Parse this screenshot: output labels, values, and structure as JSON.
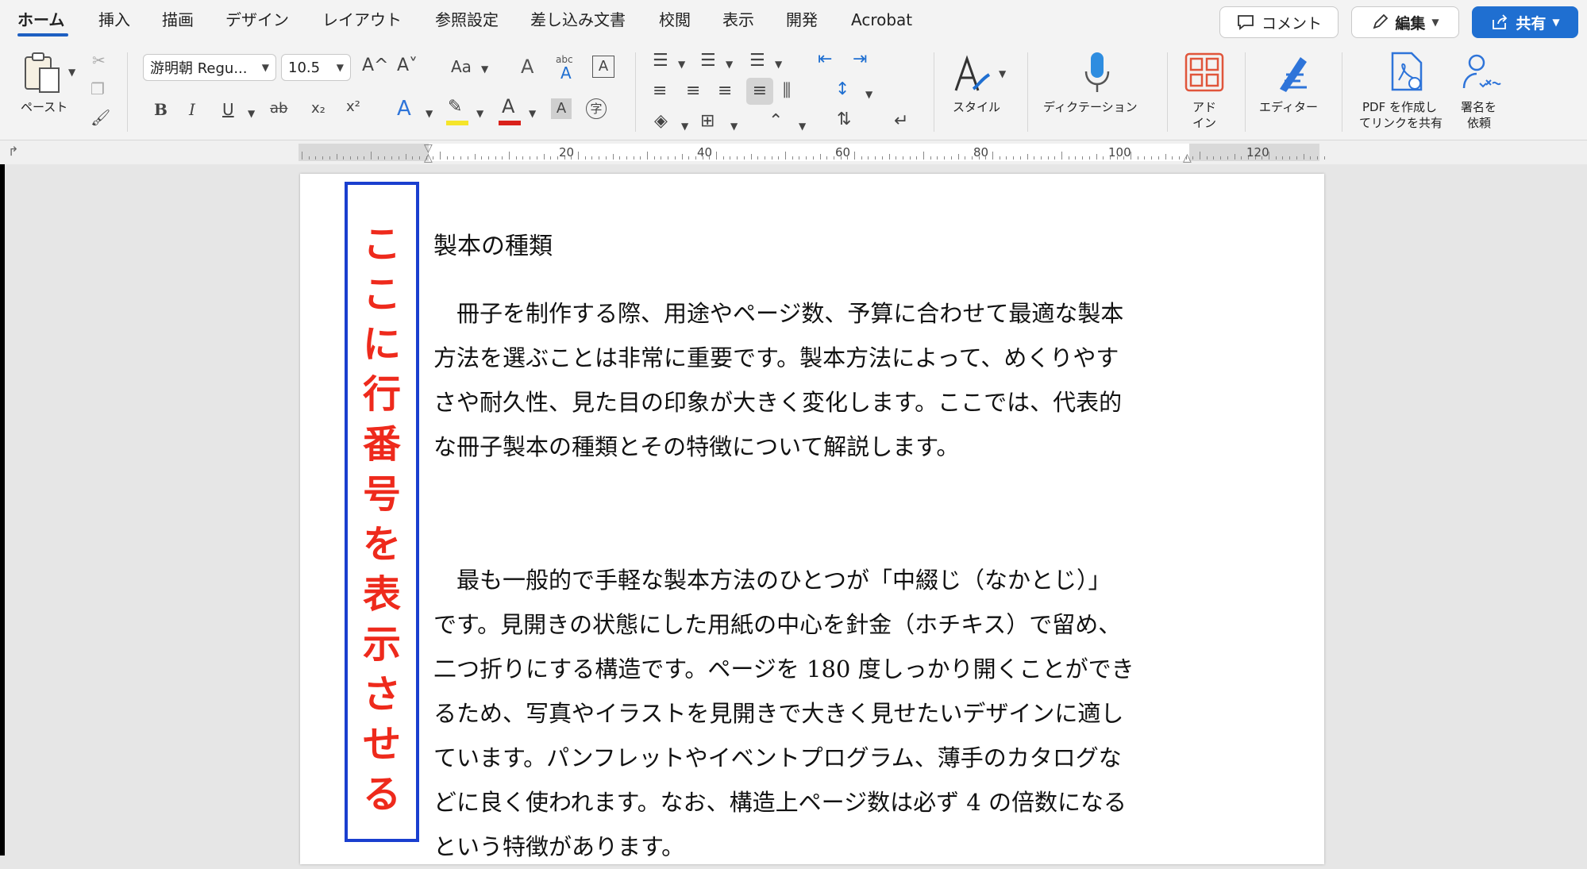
{
  "tabs": [
    {
      "label": "ホーム",
      "active": true
    },
    {
      "label": "挿入"
    },
    {
      "label": "描画"
    },
    {
      "label": "デザイン"
    },
    {
      "label": "レイアウト"
    },
    {
      "label": "参照設定"
    },
    {
      "label": "差し込み文書"
    },
    {
      "label": "校閲"
    },
    {
      "label": "表示"
    },
    {
      "label": "開発"
    },
    {
      "label": "Acrobat"
    }
  ],
  "top_buttons": {
    "comment": "コメント",
    "edit": "編集",
    "share": "共有"
  },
  "ribbon": {
    "paste_label": "ペースト",
    "font_name": "游明朝 Regu...",
    "font_size": "10.5",
    "styles_label": "スタイル",
    "dictation_label": "ディクテーション",
    "addin_label_1": "アド",
    "addin_label_2": "イン",
    "editor_label": "エディター",
    "pdf_label_1": "PDF を作成し",
    "pdf_label_2": "てリンクを共有",
    "sign_label_1": "署名を",
    "sign_label_2": "依頼",
    "grow_font": "A^",
    "shrink_font": "A˅",
    "change_case": "Aa",
    "bold": "B",
    "italic": "I",
    "underline": "U",
    "strike": "ab",
    "subscript": "x₂",
    "superscript": "x²",
    "font_color_letter": "A",
    "char_shading": "A",
    "enclose_char": "字",
    "abc": "abc"
  },
  "ruler": {
    "labels": [
      "20",
      "40",
      "60",
      "80",
      "100",
      "120"
    ]
  },
  "colors": {
    "accent": "#1d5fc2",
    "annotation_border": "#1a3fcf",
    "annotation_text": "#ee2a1c",
    "highlight": "#f5e52a",
    "font_red": "#d9211b"
  },
  "annotation": {
    "chars": [
      "こ",
      "こ",
      "に",
      "行",
      "番",
      "号",
      "を",
      "表",
      "示",
      "さ",
      "せ",
      "る"
    ]
  },
  "document": {
    "title": "製本の種類",
    "para1": [
      "　冊子を制作する際、用途やページ数、予算に合わせて最適な製本",
      "方法を選ぶことは非常に重要です。製本方法によって、めくりやす",
      "さや耐久性、見た目の印象が大きく変化します。ここでは、代表的",
      "な冊子製本の種類とその特徴について解説します。"
    ],
    "para2": [
      "　最も一般的で手軽な製本方法のひとつが「中綴じ（なかとじ）」",
      "です。見開きの状態にした用紙の中心を針金（ホチキス）で留め、",
      "二つ折りにする構造です。ページを 180 度しっかり開くことができ",
      "るため、写真やイラストを見開きで大きく見せたいデザインに適し",
      "ています。パンフレットやイベントプログラム、薄手のカタログな",
      "どに良く使われます。なお、構造上ページ数は必ず 4 の倍数になる",
      "という特徴があります。"
    ]
  }
}
